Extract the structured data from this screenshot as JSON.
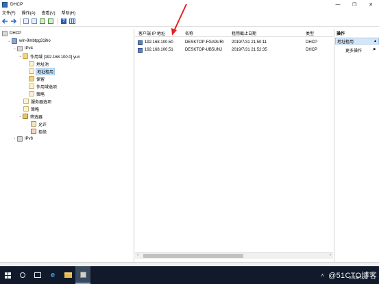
{
  "window": {
    "title": "DHCP",
    "controls": [
      "—",
      "❐",
      "✕"
    ]
  },
  "menu": [
    "文件(F)",
    "操作(A)",
    "查看(V)",
    "帮助(H)"
  ],
  "tree": {
    "root": "DHCP",
    "server": "win-9mbtpg31iho",
    "ipv4": "IPv4",
    "scope": "作用域 [192.168.100.0] yun",
    "address_pool": "地址池",
    "address_leases": "地址租用",
    "reservations": "保留",
    "scope_options": "作用域选项",
    "policies": "策略",
    "server_options": "服务器选项",
    "policies2": "策略",
    "filters": "筛选器",
    "allow": "允许",
    "deny": "拒绝",
    "ipv6": "IPv6"
  },
  "list": {
    "columns": [
      "客户端 IP 地址",
      "名称",
      "租用截止日期",
      "类型"
    ],
    "rows": [
      {
        "ip": "192.168.100.50",
        "name": "DESKTOP-FGA9URI",
        "expires": "2019/7/31 21:50:11",
        "type": "DHCP"
      },
      {
        "ip": "192.168.100.51",
        "name": "DESKTOP-UB5UNJ",
        "expires": "2019/7/31 21:52:35",
        "type": "DHCP"
      }
    ]
  },
  "actions": {
    "header": "操作",
    "section": "地址租用",
    "more": "更多操作"
  },
  "taskbar": {
    "watermark": "@51CTO博客",
    "date": "2019/7/23"
  }
}
